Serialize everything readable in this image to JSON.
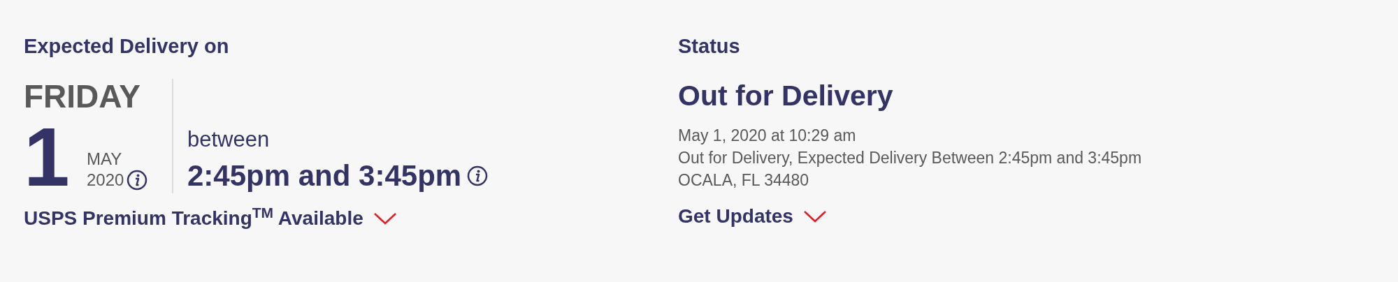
{
  "delivery": {
    "heading": "Expected Delivery on",
    "weekday": "FRIDAY",
    "day": "1",
    "month": "MAY",
    "year": "2020",
    "between_label": "between",
    "time_range": "2:45pm and 3:45pm",
    "premium_link": "USPS Premium Tracking$^{TM}$ Available"
  },
  "status": {
    "heading": "Status",
    "title": "Out for Delivery",
    "details": [
      "May 1, 2020 at 10:29 am",
      "Out for Delivery, Expected Delivery Between 2:45pm and 3:45pm",
      "OCALA, FL 34480"
    ],
    "updates_link": "Get Updates"
  }
}
